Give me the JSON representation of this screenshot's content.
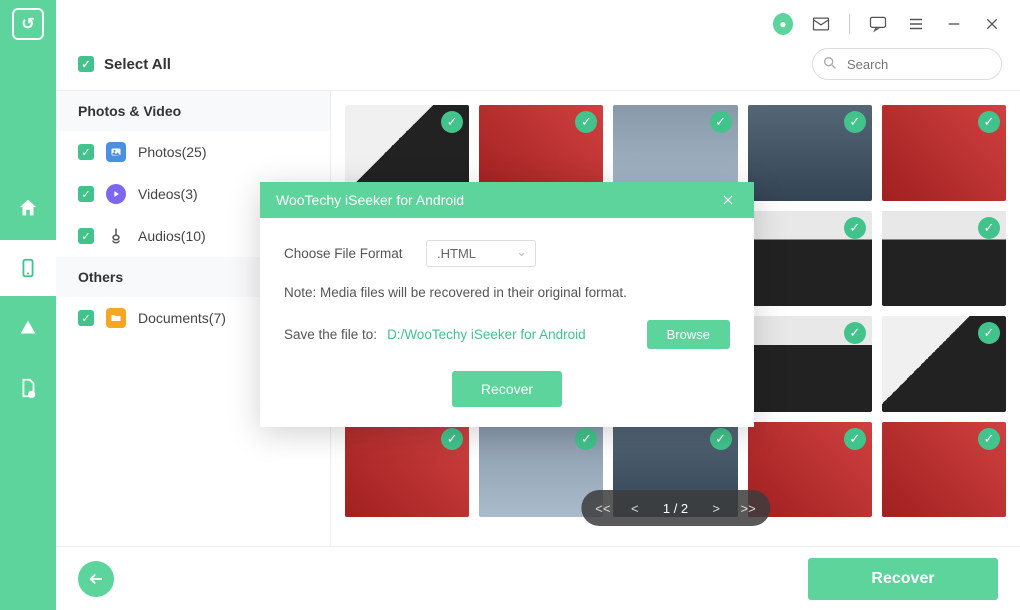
{
  "app_title": "WooTechy iSeeker for Android",
  "titlebar": {},
  "topbar": {
    "select_all": "Select All",
    "search_placeholder": "Search"
  },
  "sidebar": {
    "section1": "Photos & Video",
    "items1": [
      {
        "label": "Photos(25)",
        "icon": "photo"
      },
      {
        "label": "Videos(3)",
        "icon": "video"
      },
      {
        "label": "Audios(10)",
        "icon": "audio"
      }
    ],
    "section2": "Others",
    "items2": [
      {
        "label": "Documents(7)",
        "icon": "doc"
      }
    ]
  },
  "pager": {
    "page_text": "1 / 2"
  },
  "bottombar": {
    "recover": "Recover"
  },
  "modal": {
    "title": "WooTechy iSeeker for Android",
    "choose_label": "Choose File Format",
    "format_value": ".HTML",
    "note": "Note: Media files will be recovered in their original format.",
    "save_label": "Save the file to:",
    "save_path": "D:/WooTechy iSeeker for Android",
    "browse": "Browse",
    "recover": "Recover"
  },
  "thumbnails": [
    "ph1",
    "ph2",
    "ph3",
    "ph4",
    "ph2",
    "ph2",
    "ph2",
    "ph5",
    "ph6",
    "ph6",
    "ph6",
    "ph6",
    "ph6",
    "ph6"
  ]
}
